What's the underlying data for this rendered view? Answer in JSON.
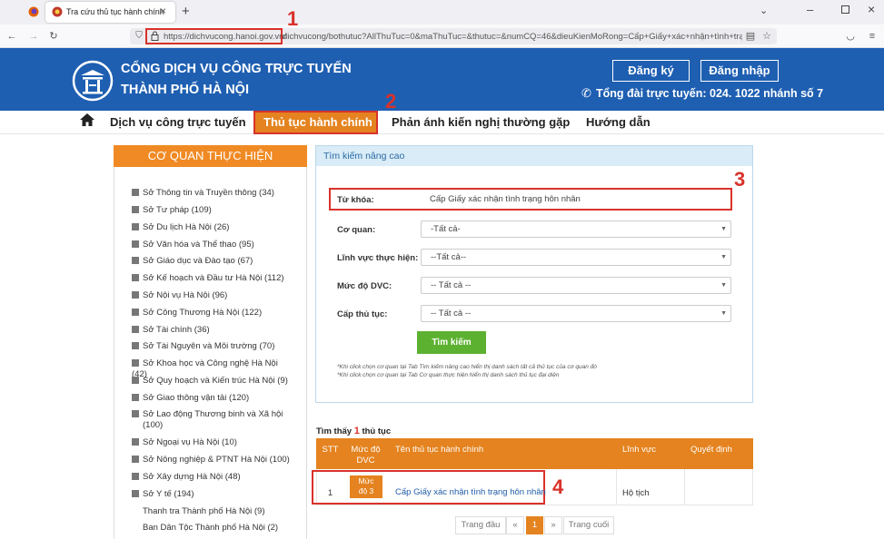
{
  "browser": {
    "tab_title": "Tra cứu thủ tục hành chính",
    "url_domain": "https://dichvucong.hanoi.gov.vn/",
    "url_rest": "dichvucong/bothutuc?AllThuTuc=0&maThuTuc=&thutuc=&numCQ=46&dieuKienMoRong=Cấp+Giấy+xác+nhận+tình+trạng+hôn"
  },
  "header": {
    "title_line1": "CỔNG DỊCH VỤ CÔNG TRỰC TUYẾN",
    "title_line2": "THÀNH PHỐ HÀ NỘI",
    "register": "Đăng ký",
    "login": "Đăng nhập",
    "hotline": "Tổng đài trực tuyến: 024. 1022 nhánh số 7"
  },
  "nav": {
    "items": [
      "Dịch vụ công trực tuyến",
      "Thủ tục hành chính",
      "Phản ánh kiến nghị thường gặp",
      "Hướng dẫn"
    ]
  },
  "sidebar": {
    "title": "CƠ QUAN THỰC HIỆN",
    "items": [
      "Sở Thông tin và Truyền thông (34)",
      "Sở Tư pháp (109)",
      "Sở Du lịch Hà Nội (26)",
      "Sở Văn hóa và Thể thao (95)",
      "Sở Giáo dục và Đào tạo (67)",
      "Sở Kế hoạch và Đầu tư Hà Nội (112)",
      "Sở Nội vụ Hà Nội (96)",
      "Sở Công Thương Hà Nội (122)",
      "Sở Tài chính (36)",
      "Sở Tài Nguyên và Môi trường (70)",
      "Sở Khoa học và Công nghệ Hà Nội (42)",
      "Sở Quy hoạch và Kiến trúc Hà Nội (9)",
      "Sở Giao thông vận tải (120)",
      "Sở Lao động Thương binh và Xã hội",
      "(100)",
      "Sở Ngoại vụ Hà Nội (10)",
      "Sở Nông nghiệp & PTNT Hà Nội (100)",
      "Sở Xây dựng Hà Nội (48)",
      "Sở Y tế (194)",
      "Thanh tra Thành phố Hà Nội (9)",
      "Ban Dân Tộc Thành phố Hà Nội (2)"
    ]
  },
  "search": {
    "panel_title": "Tìm kiếm nâng cao",
    "keyword_label": "Từ khóa:",
    "keyword_value": "Cấp Giấy xác nhận tình trạng hôn nhân",
    "agency_label": "Cơ quan:",
    "agency_value": "-Tất cả-",
    "field_label": "Lĩnh vực thực hiện:",
    "field_value": "--Tất cả--",
    "level_label": "Mức độ DVC:",
    "level_value": "-- Tất cả --",
    "tier_label": "Cấp thủ tục:",
    "tier_value": "-- Tất cả --",
    "button": "Tìm kiếm",
    "note1": "*Khi click chọn cơ quan tại Tab Tìm kiếm nâng cao hiển thị danh sách tất cả thủ tục của cơ quan đó",
    "note2": "*Khi click chọn cơ quan tại Tab Cơ quan thực hiện hiển thị danh sách thủ tục đại diện"
  },
  "results": {
    "found_prefix": "Tìm thấy",
    "found_count": "1",
    "found_suffix": "thủ tục",
    "headers": {
      "stt": "STT",
      "level_l1": "Mức độ",
      "level_l2": "DVC",
      "name": "Tên thủ tục hành chính",
      "field": "Lĩnh vực",
      "decision": "Quyết định"
    },
    "row": {
      "stt": "1",
      "level_l1": "Mức",
      "level_l2": "độ 3",
      "name": "Cấp Giấy xác nhận tình trạng hôn nhân",
      "field": "Hộ tịch"
    }
  },
  "pagination": {
    "first": "Trang đầu",
    "prev": "«",
    "current": "1",
    "next": "»",
    "last": "Trang cuối"
  },
  "annotations": [
    "1",
    "2",
    "3",
    "4"
  ],
  "colors": {
    "header_blue": "#1e5fb2",
    "orange": "#e4831f",
    "green": "#5db131",
    "annotation_red": "#d9322a"
  }
}
